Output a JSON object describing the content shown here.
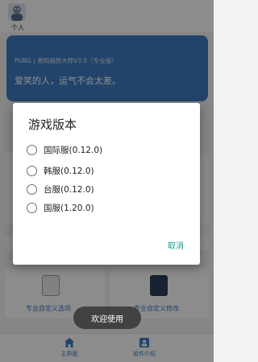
{
  "header": {
    "avatar_label": "个人"
  },
  "banner": {
    "title": "PUBG | 易阳画质大师V3.0（专业版）",
    "quote": "爱笑的人，运气不会太差。"
  },
  "background_items": [
    {
      "label": "专业自定义选项"
    },
    {
      "label": "专业自定义修改"
    }
  ],
  "bottom_nav": {
    "items": [
      {
        "label": "主界面"
      },
      {
        "label": "软件介绍"
      }
    ]
  },
  "dialog": {
    "title": "游戏版本",
    "options": [
      {
        "label": "国际服(0.12.0)",
        "selected": false
      },
      {
        "label": "韩服(0.12.0)",
        "selected": false
      },
      {
        "label": "台服(0.12.0)",
        "selected": false
      },
      {
        "label": "国服(1.20.0)",
        "selected": false
      }
    ],
    "cancel_label": "取消"
  },
  "toast": {
    "text": "欢迎使用"
  },
  "colors": {
    "accent": "#1a9a8e",
    "brand_blue": "#3f7cc4",
    "scrim": "rgba(0,0,0,0.45)"
  }
}
